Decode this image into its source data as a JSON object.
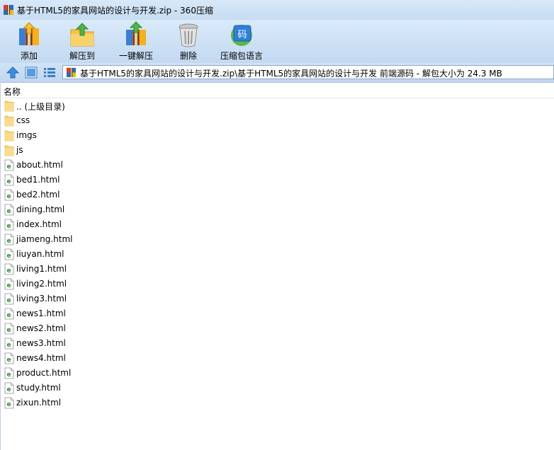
{
  "window": {
    "title": "基于HTML5的家具网站的设计与开发.zip - 360压缩"
  },
  "toolbar": {
    "buttons": [
      {
        "label": "添加",
        "icon": "add-archive-icon"
      },
      {
        "label": "解压到",
        "icon": "extract-to-icon"
      },
      {
        "label": "一键解压",
        "icon": "one-click-extract-icon"
      },
      {
        "label": "删除",
        "icon": "delete-trash-icon"
      },
      {
        "label": "压缩包语言",
        "icon": "archive-language-icon"
      }
    ]
  },
  "address": {
    "path": "基于HTML5的家具网站的设计与开发.zip\\基于HTML5的家具网站的设计与开发 前端源码 - 解包大小为 24.3 MB"
  },
  "list": {
    "column_name": "名称",
    "items": [
      {
        "name": ".. (上级目录)",
        "type": "folder"
      },
      {
        "name": "css",
        "type": "folder"
      },
      {
        "name": "imgs",
        "type": "folder"
      },
      {
        "name": "js",
        "type": "folder"
      },
      {
        "name": "about.html",
        "type": "html"
      },
      {
        "name": "bed1.html",
        "type": "html"
      },
      {
        "name": "bed2.html",
        "type": "html"
      },
      {
        "name": "dining.html",
        "type": "html"
      },
      {
        "name": "index.html",
        "type": "html"
      },
      {
        "name": "jiameng.html",
        "type": "html"
      },
      {
        "name": "liuyan.html",
        "type": "html"
      },
      {
        "name": "living1.html",
        "type": "html"
      },
      {
        "name": "living2.html",
        "type": "html"
      },
      {
        "name": "living3.html",
        "type": "html"
      },
      {
        "name": "news1.html",
        "type": "html"
      },
      {
        "name": "news2.html",
        "type": "html"
      },
      {
        "name": "news3.html",
        "type": "html"
      },
      {
        "name": "news4.html",
        "type": "html"
      },
      {
        "name": "product.html",
        "type": "html"
      },
      {
        "name": "study.html",
        "type": "html"
      },
      {
        "name": "zixun.html",
        "type": "html"
      }
    ]
  }
}
